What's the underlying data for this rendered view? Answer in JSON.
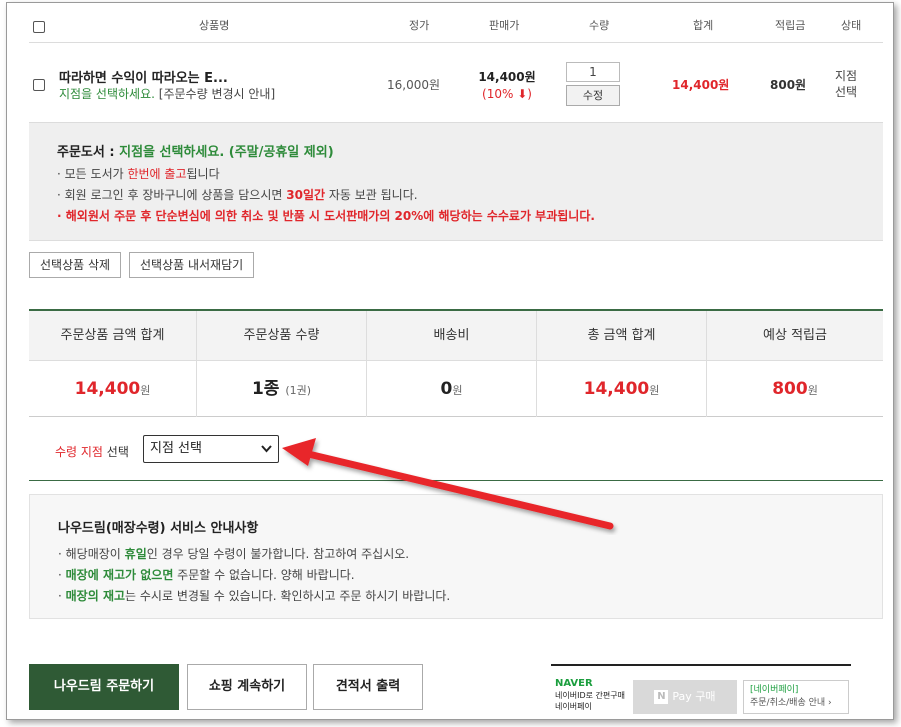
{
  "table": {
    "headers": [
      "상품명",
      "정가",
      "판매가",
      "수량",
      "합계",
      "적립금",
      "상태"
    ]
  },
  "item": {
    "title": "따라하면 수익이 따라오는 E...",
    "branch_prompt": "지점을 선택하세요.",
    "order_qty_note": "[주문수량 변경시 안내]",
    "list_price": "16,000원",
    "sale_price": "14,400원",
    "discount": "(10% ⬇)",
    "quantity": "1",
    "qty_button": "수정",
    "total": "14,400원",
    "points": "800원",
    "status_line1": "지점",
    "status_line2": "선택"
  },
  "notice": {
    "heading_label": "주문도서 :",
    "heading_value": "지점을 선택하세요. (주말/공휴일 제외)",
    "line1_a": "· 모든 도서가 ",
    "line1_b": "한번에 출고",
    "line1_c": "됩니다",
    "line2_a": "· 회원 로그인 후 장바구니에 상품을 담으시면 ",
    "line2_b": "30일간",
    "line2_c": " 자동 보관 됩니다.",
    "line3": "· 해외원서 주문 후 단순변심에 의한 취소 및 반품 시 도서판매가의 20%에 해당하는 수수료가 부과됩니다."
  },
  "actions": {
    "delete_selected": "선택상품 삭제",
    "save_selected": "선택상품 내서재담기"
  },
  "summary": {
    "labels": [
      "주문상품 금액 합계",
      "주문상품 수량",
      "배송비",
      "총 금액 합계",
      "예상 적립금"
    ],
    "amount": "14,400",
    "count": "1종",
    "count_sub": "(1권)",
    "shipping": "0",
    "total": "14,400",
    "points": "800",
    "unit": "원"
  },
  "pickup": {
    "label_a": "수령 지점",
    "label_b": " 선택",
    "select_value": "지점 선택"
  },
  "info": {
    "heading": "나우드림(매장수령) 서비스 안내사항",
    "line1_a": "· 해당매장이 ",
    "line1_b": "휴일",
    "line1_c": "인 경우 당일 수령이 불가합니다. 참고하여 주십시오.",
    "line2_a": "· ",
    "line2_b": "매장에 재고가 없으면",
    "line2_c": " 주문할 수 없습니다. 양해 바랍니다.",
    "line3_a": "· ",
    "line3_b": "매장의 재고",
    "line3_c": "는 수시로 변경될 수 있습니다. 확인하시고 주문 하시기 바랍니다."
  },
  "bottom": {
    "order_button": "나우드림 주문하기",
    "continue_button": "쇼핑 계속하기",
    "quote_button": "견적서 출력",
    "naver_logo": "NAVER",
    "naver_desc1": "네이버ID로 간편구매",
    "naver_desc2": "네이버페이",
    "pay_n": "N",
    "pay_label": "Pay 구매",
    "pay_link_a": "[네이버페이]",
    "pay_link_b": "주문/취소/배송 안내 ›"
  },
  "colors": {
    "accent_red": "#e0262b",
    "accent_green": "#2e8b3a",
    "primary_button": "#2f5a35",
    "arrow": "#e8262b"
  }
}
